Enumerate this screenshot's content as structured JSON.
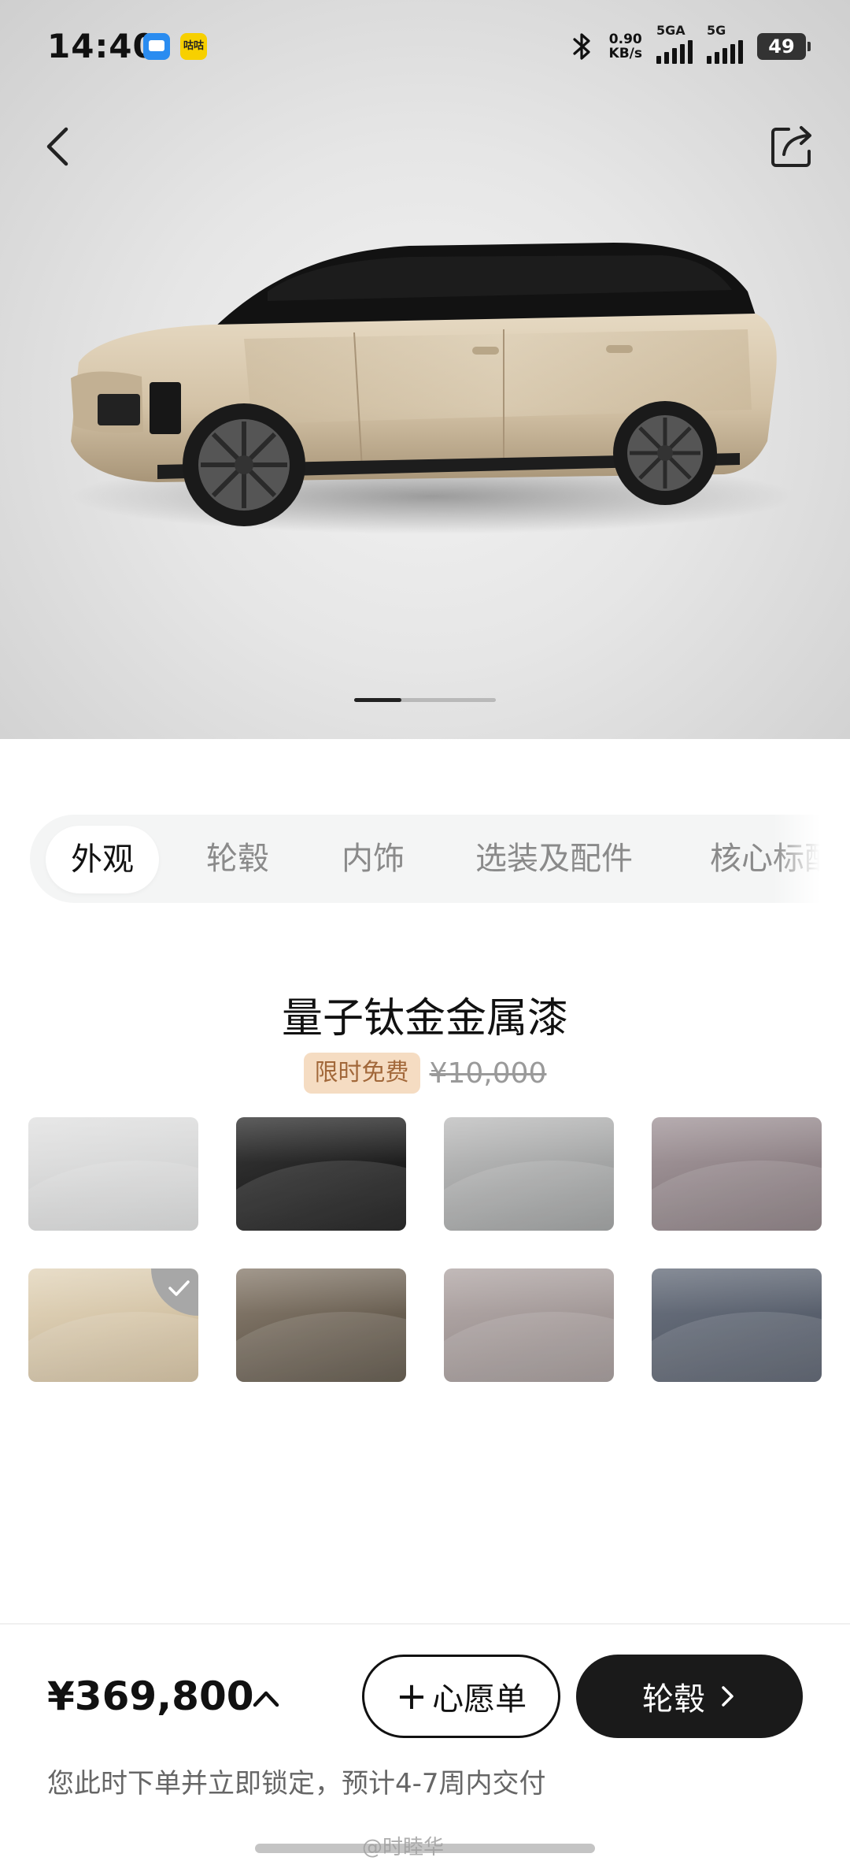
{
  "status_bar": {
    "time": "14:40",
    "app_badge_2": "咕咕",
    "net_speed_value": "0.90",
    "net_speed_unit": "KB/s",
    "sim1_label": "5GA",
    "sim2_label": "5G",
    "battery": "49"
  },
  "hero": {
    "paint_color": "#d3c2a6",
    "roof_color": "#111111",
    "pager_total": 3,
    "pager_active_index": 0
  },
  "tabs": [
    {
      "label": "外观",
      "active": true
    },
    {
      "label": "轮毂",
      "active": false
    },
    {
      "label": "内饰",
      "active": false
    },
    {
      "label": "选装及配件",
      "active": false
    },
    {
      "label": "核心标配",
      "active": false
    }
  ],
  "selected_color": {
    "name": "量子钛金金属漆",
    "tag": "限时免费",
    "original_price": "¥10,000"
  },
  "swatches": [
    {
      "color_top": "#e2e2e2",
      "color_bottom": "#cfd0d0",
      "selected": false
    },
    {
      "color_top": "#3a3a3a",
      "color_bottom": "#0c0c0c",
      "selected": false
    },
    {
      "color_top": "#c0c0c0",
      "color_bottom": "#909292",
      "selected": false
    },
    {
      "color_top": "#a69a9e",
      "color_bottom": "#7d7074",
      "selected": false
    },
    {
      "color_top": "#e3d6bd",
      "color_bottom": "#c8b594",
      "selected": true
    },
    {
      "color_top": "#8e8274",
      "color_bottom": "#4f4639",
      "selected": false
    },
    {
      "color_top": "#b4aaa9",
      "color_bottom": "#958b8a",
      "selected": false
    },
    {
      "color_top": "#6c7380",
      "color_bottom": "#4b525f",
      "selected": false
    }
  ],
  "bottom": {
    "total_price": "¥369,800",
    "wishlist_plus": "+",
    "wishlist_label": "心愿单",
    "next_label": "轮毂",
    "delivery_note": "您此时下单并立即锁定，预计4-7周内交付"
  },
  "watermark": "@时睦华"
}
